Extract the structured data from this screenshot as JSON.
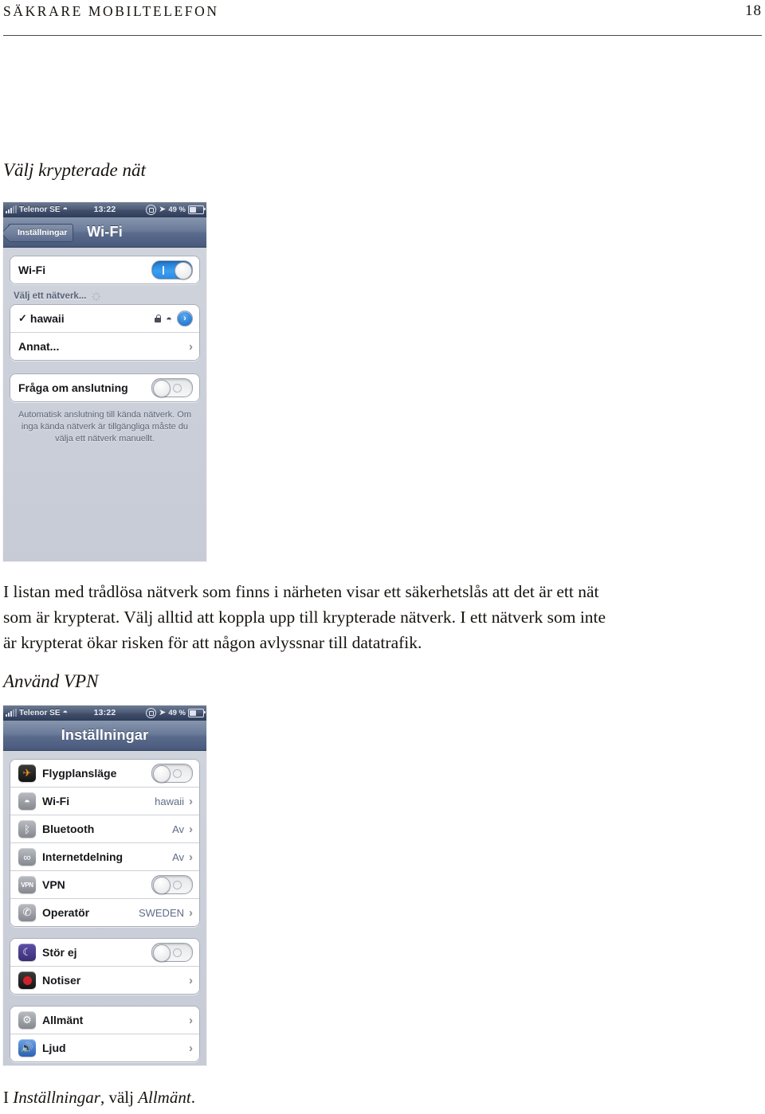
{
  "page": {
    "running_head": "SÄKRARE MOBILTELEFON",
    "folio": "18"
  },
  "sections": {
    "wifi": {
      "heading": "Välj krypterade nät",
      "paragraph": "I listan med trådlösa nätverk som finns i närheten visar ett säkerhetslås att det är ett nät som är krypterat. Välj alltid att koppla upp till krypterade nätverk. I ett nätverk som inte är krypterat ökar risken för att någon avlyssnar till datatrafik."
    },
    "vpn": {
      "heading": "Använd VPN",
      "caption_part1": "I ",
      "caption_em1": "Inställningar",
      "caption_part2": ", välj ",
      "caption_em2": "Allmänt",
      "caption_part3": "."
    }
  },
  "shot_wifi": {
    "statusbar": {
      "carrier": "Telenor SE",
      "wifi_icon": "wifi-icon",
      "time": "13:22",
      "rotation_lock_icon": "rotation-lock-icon",
      "location_icon": "location-arrow-icon",
      "battery_percent": "49 %",
      "battery_icon": "battery-icon"
    },
    "navbar": {
      "back_label": "Inställningar",
      "title": "Wi-Fi"
    },
    "wifi_row": {
      "label": "Wi-Fi",
      "toggle_state": "on"
    },
    "network_group_header": "Välj ett nätverk...",
    "networks": [
      {
        "name": "hawaii",
        "selected": true,
        "secured": true,
        "signal_icon": "wifi-icon",
        "detail_icon": "info-detail-icon"
      },
      {
        "name": "Annat...",
        "selected": false,
        "secured": false,
        "chevron": "chevron-right-icon"
      }
    ],
    "ask_row": {
      "label": "Fråga om anslutning",
      "toggle_state": "off"
    },
    "footnote": "Automatisk anslutning till kända nätverk. Om inga kända nätverk är tillgängliga måste du välja ett nätverk manuellt."
  },
  "shot_settings": {
    "statusbar": {
      "carrier": "Telenor SE",
      "wifi_icon": "wifi-icon",
      "time": "13:22",
      "rotation_lock_icon": "rotation-lock-icon",
      "location_icon": "location-arrow-icon",
      "battery_percent": "49 %",
      "battery_icon": "battery-icon"
    },
    "navbar": {
      "title": "Inställningar"
    },
    "group1": [
      {
        "label": "Flygplansläge",
        "icon": "airplane-icon",
        "control": "toggle",
        "toggle_state": "off",
        "value": ""
      },
      {
        "label": "Wi-Fi",
        "icon": "wifi-icon",
        "control": "chevron",
        "value": "hawaii"
      },
      {
        "label": "Bluetooth",
        "icon": "bluetooth-icon",
        "control": "chevron",
        "value": "Av"
      },
      {
        "label": "Internetdelning",
        "icon": "tethering-icon",
        "control": "chevron",
        "value": "Av"
      },
      {
        "label": "VPN",
        "icon": "vpn-icon",
        "control": "toggle",
        "toggle_state": "off",
        "value": ""
      },
      {
        "label": "Operatör",
        "icon": "phone-icon",
        "control": "chevron",
        "value": "SWEDEN"
      }
    ],
    "group2": [
      {
        "label": "Stör ej",
        "icon": "moon-icon",
        "control": "toggle",
        "toggle_state": "off",
        "value": ""
      },
      {
        "label": "Notiser",
        "icon": "notifications-icon",
        "control": "chevron",
        "value": ""
      }
    ],
    "group3": [
      {
        "label": "Allmänt",
        "icon": "gear-icon",
        "control": "chevron",
        "value": ""
      },
      {
        "label": "Ljud",
        "icon": "speaker-icon",
        "control": "chevron",
        "value": ""
      }
    ]
  },
  "colors": {
    "accent_blue": "#1569c8",
    "toggle_on": "#2b8ae4",
    "value_text": "#5f6b85",
    "paper": "#ffffff",
    "ink": "#17140f"
  },
  "glyphs": {
    "chevron_right": "›",
    "checkmark": "✓",
    "wifi": "◠",
    "location_arrow": "➤",
    "info_chevron": "›",
    "airplane": "✈",
    "bluetooth": "ᛒ",
    "tethering": "∞",
    "vpn": "VPN",
    "phone": "✆",
    "moon": "☾",
    "gear": "⚙",
    "speaker": "🔊"
  }
}
